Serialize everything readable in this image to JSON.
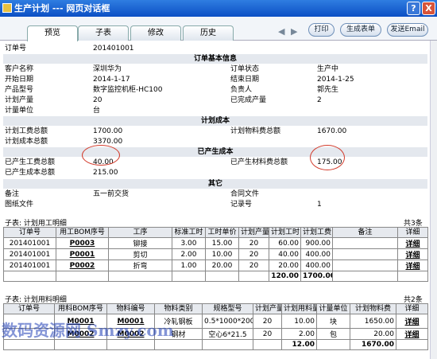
{
  "window": {
    "title": "生产计划 --- 网页对话框",
    "help": "?",
    "close": "X"
  },
  "tabs": [
    "预览",
    "子表",
    "修改",
    "历史"
  ],
  "nav": {
    "prev": "◀",
    "next": "▶"
  },
  "buttons": {
    "print": "打印",
    "generate": "生成表单",
    "email": "发送Email"
  },
  "order": {
    "no_label": "订单号",
    "no_value": "201401001",
    "basic_title": "订单基本信息",
    "customer_label": "客户名称",
    "customer_value": "深圳华为",
    "status_label": "订单状态",
    "status_value": "生产中",
    "start_label": "开始日期",
    "start_value": "2014-1-17",
    "end_label": "结束日期",
    "end_value": "2014-1-25",
    "model_label": "产品型号",
    "model_value": "数字监控机柜-HC100",
    "owner_label": "负责人",
    "owner_value": "郭先生",
    "planqty_label": "计划产量",
    "planqty_value": "20",
    "doneqty_label": "已完成产量",
    "doneqty_value": "2",
    "unit_label": "计量单位",
    "unit_value": "台",
    "plancost_title": "计划成本",
    "planlabor_label": "计划工费总额",
    "planlabor_value": "1700.00",
    "planmat_label": "计划物料费总额",
    "planmat_value": "1670.00",
    "plantotal_label": "计划成本总额",
    "plantotal_value": "3370.00",
    "actual_title": "已产生成本",
    "actlabor_label": "已产生工费总额",
    "actlabor_value": "40.00",
    "actmat_label": "已产生材料费总额",
    "actmat_value": "175.00",
    "acttotal_label": "已产生成本总额",
    "acttotal_value": "215.00",
    "other_title": "其它",
    "note_label": "备注",
    "note_value": "五一前交货",
    "contract_label": "合同文件",
    "contract_value": "",
    "drawing_label": "图纸文件",
    "drawing_value": "",
    "record_label": "记录号",
    "record_value": "1"
  },
  "labor": {
    "title": "子表: 计划用工明细",
    "count": "共3条",
    "headers": [
      "订单号",
      "用工BOM序号",
      "工序",
      "标准工时",
      "工时单价",
      "计划产量",
      "计划工时",
      "计划工费",
      "备注",
      "详细"
    ],
    "rows": [
      [
        "201401001",
        "P0003",
        "铆接",
        "3.00",
        "15.00",
        "20",
        "60.00",
        "900.00",
        "",
        "详细"
      ],
      [
        "201401001",
        "P0001",
        "剪切",
        "2.00",
        "10.00",
        "20",
        "40.00",
        "400.00",
        "",
        "详细"
      ],
      [
        "201401001",
        "P0002",
        "折弯",
        "1.00",
        "20.00",
        "20",
        "20.00",
        "400.00",
        "",
        "详细"
      ]
    ],
    "total_hours": "120.00",
    "total_cost": "1700.00"
  },
  "material": {
    "title": "子表: 计划用料明细",
    "count": "共2条",
    "headers": [
      "订单号",
      "用料BOM序号",
      "物料编号",
      "物料类别",
      "规格型号",
      "计划产量",
      "计划用料量",
      "计量单位",
      "计划物料费",
      "详细"
    ],
    "rows": [
      [
        "",
        "M0001",
        "M0001",
        "冷轧钢板",
        "0.5*1000*2000",
        "20",
        "10.00",
        "块",
        "1650.00",
        "详细"
      ],
      [
        "",
        "M0002",
        "M0002",
        "钢材",
        "空心6*21.5",
        "20",
        "2.00",
        "包",
        "20.00",
        "详细"
      ]
    ],
    "total_qty": "12.00",
    "total_cost": "1670.00"
  },
  "watermark": "数码资源网 Smzy.com"
}
